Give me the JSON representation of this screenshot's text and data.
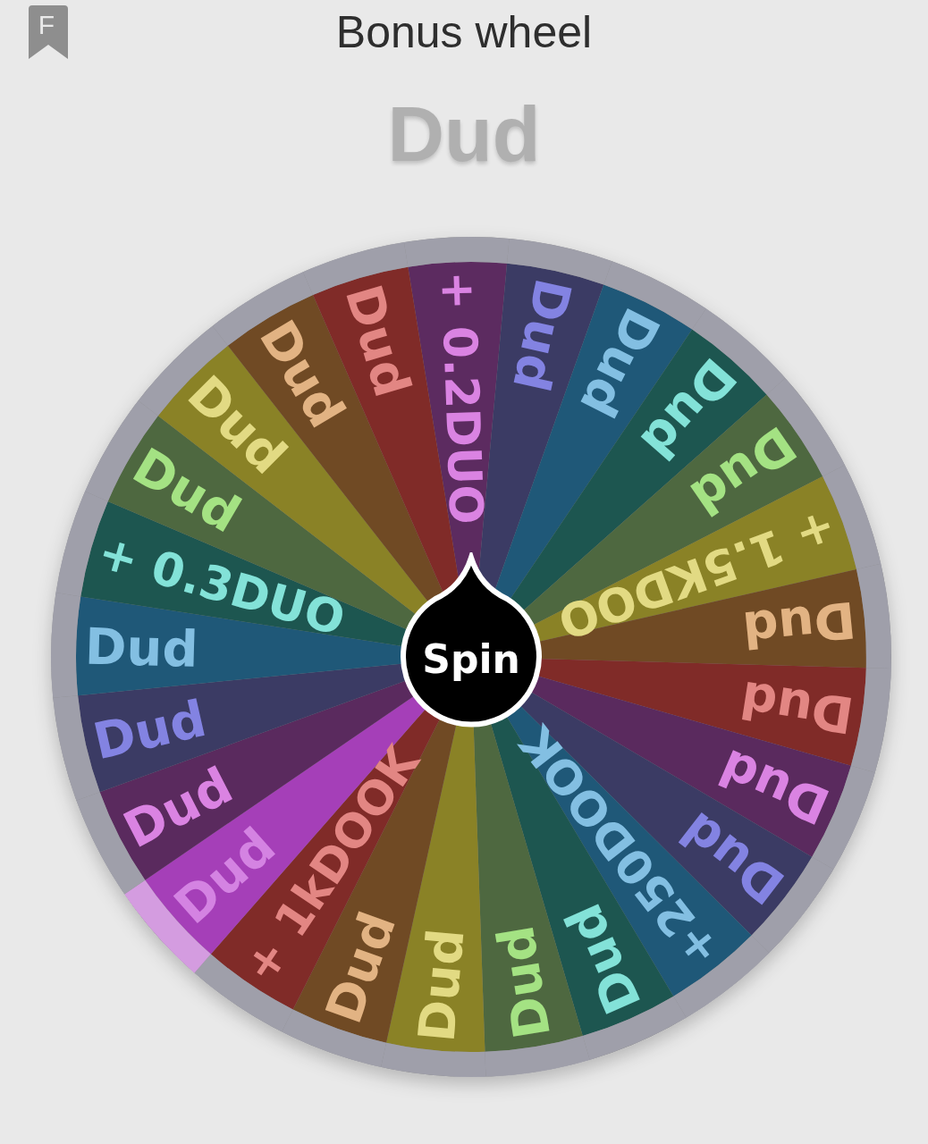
{
  "bookmark": {
    "letter": "F"
  },
  "title": "Bonus wheel",
  "result": "Dud",
  "spin_button": {
    "label": "Spin"
  },
  "segments": [
    {
      "label": "+ 0.2DUO",
      "color": "#5c2b60",
      "selected": false
    },
    {
      "label": "Dud",
      "color": "#3b3b64",
      "selected": false
    },
    {
      "label": "Dud",
      "color": "#1f5878",
      "selected": false
    },
    {
      "label": "Dud",
      "color": "#1d5650",
      "selected": false
    },
    {
      "label": "Dud",
      "color": "#4e6840",
      "selected": false
    },
    {
      "label": "+ 1.5KDOO",
      "color": "#8a8226",
      "selected": false
    },
    {
      "label": "Dud",
      "color": "#704a24",
      "selected": false
    },
    {
      "label": "Dud",
      "color": "#802b28",
      "selected": false
    },
    {
      "label": "Dud",
      "color": "#5a2a5e",
      "selected": false
    },
    {
      "label": "Dud",
      "color": "#3b3b64",
      "selected": false
    },
    {
      "label": "+250DOOK",
      "color": "#1f5878",
      "selected": false
    },
    {
      "label": "Dud",
      "color": "#1d5650",
      "selected": false
    },
    {
      "label": "Dud",
      "color": "#4e6840",
      "selected": false
    },
    {
      "label": "Dud",
      "color": "#8a8226",
      "selected": false
    },
    {
      "label": "Dud",
      "color": "#704a24",
      "selected": false
    },
    {
      "label": "+ 1kDOOK",
      "color": "#802b28",
      "selected": false
    },
    {
      "label": "Dud",
      "color": "#a53fb8",
      "selected": true
    },
    {
      "label": "Dud",
      "color": "#5a2a5e",
      "selected": false
    },
    {
      "label": "Dud",
      "color": "#3b3b64",
      "selected": false
    },
    {
      "label": "Dud",
      "color": "#1f5878",
      "selected": false
    },
    {
      "label": "+ 0.3DUO",
      "color": "#1d5650",
      "selected": false
    },
    {
      "label": "Dud",
      "color": "#4e6840",
      "selected": false
    },
    {
      "label": "Dud",
      "color": "#8a8226",
      "selected": false
    },
    {
      "label": "Dud",
      "color": "#704a24",
      "selected": false
    },
    {
      "label": "Dud",
      "color": "#802b28",
      "selected": false
    }
  ]
}
